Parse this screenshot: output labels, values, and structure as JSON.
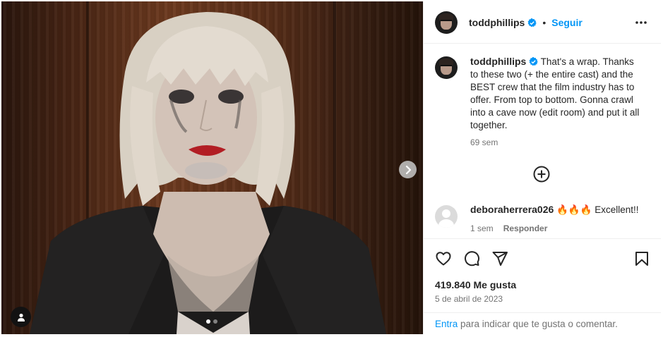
{
  "post": {
    "author": "toddphillips",
    "follow_label": "Seguir",
    "separator": "•",
    "caption": "That's a wrap. Thanks to these two (+ the entire cast) and the BEST crew that the film industry has to offer. From top to bottom. Gonna crawl into a cave now (edit room) and put it all together.",
    "caption_time": "69 sem",
    "likes": "419.840 Me gusta",
    "date": "5 de abril de 2023",
    "carousel_total": 2,
    "carousel_current": 1
  },
  "comment": {
    "author": "deboraherrera026",
    "text": "🔥🔥🔥 Excellent!!",
    "time": "1 sem",
    "reply_label": "Responder"
  },
  "login_prompt": {
    "link": "Entra",
    "text": " para indicar que te gusta o comentar."
  },
  "icons": {
    "more": "more-options-icon",
    "verified": "verified-badge-icon",
    "like": "heart-icon",
    "comment": "comment-icon",
    "share": "paper-plane-icon",
    "save": "bookmark-icon",
    "add": "add-circle-icon",
    "next": "chevron-right-icon",
    "tag": "user-tag-icon"
  },
  "colors": {
    "link": "#0095f6",
    "verified": "#0095f6",
    "muted": "#737373"
  }
}
